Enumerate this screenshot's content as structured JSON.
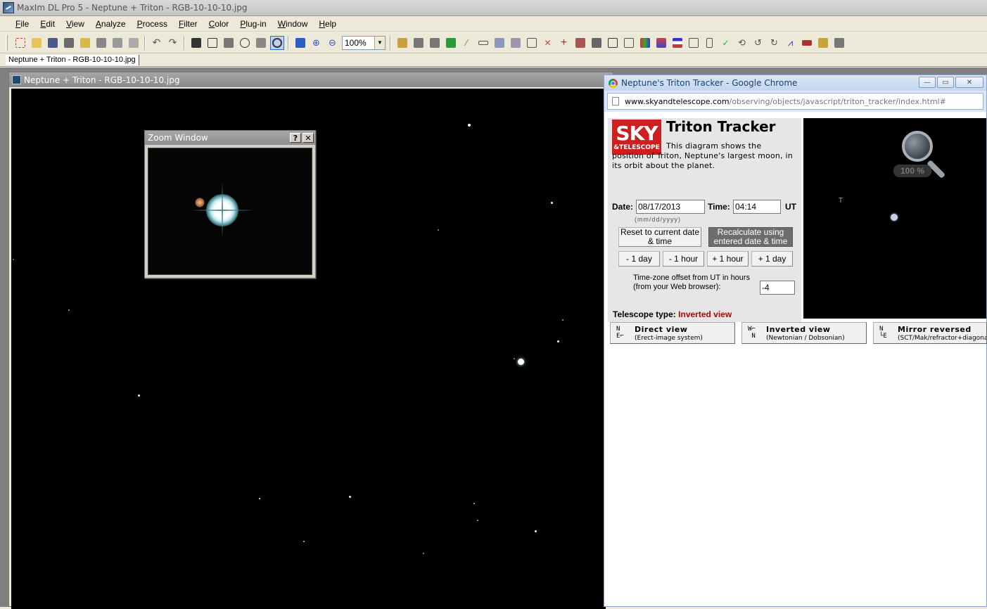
{
  "app": {
    "title": "MaxIm DL Pro 5 - Neptune + Triton - RGB-10-10-10.jpg",
    "menu": [
      "File",
      "Edit",
      "View",
      "Analyze",
      "Process",
      "Filter",
      "Color",
      "Plug-in",
      "Window",
      "Help"
    ],
    "zoom_value": "100%",
    "doc_tab": "Neptune + Triton - RGB-10-10-10.jpg"
  },
  "image_window": {
    "title": "Neptune + Triton - RGB-10-10-10.jpg"
  },
  "zoom_window": {
    "title": "Zoom Window",
    "help_label": "?",
    "close_label": "✕"
  },
  "chrome": {
    "title": "Neptune's Triton Tracker - Google Chrome",
    "url_host": "www.skyandtelescope.com",
    "url_path": "/observing/objects/javascript/triton_tracker/index.html#",
    "minimize": "—",
    "maximize": "▭",
    "close": "✕"
  },
  "tracker": {
    "logo_sky": "SKY",
    "logo_tel": "&TELESCOPE",
    "title": "Triton Tracker",
    "description": "This diagram shows the position of Triton, Neptune's largest moon, in its orbit about the planet.",
    "date_label": "Date:",
    "date_value": "08/17/2013",
    "date_hint": "(mm/dd/yyyy)",
    "time_label": "Time:",
    "time_value": "04:14",
    "ut_label": "UT",
    "reset_button": "Reset to current date & time",
    "recalc_button": "Recalculate using entered date & time",
    "step_buttons": [
      "- 1 day",
      "- 1 hour",
      "+ 1 hour",
      "+ 1 day"
    ],
    "tz_label": "Time-zone offset from UT in hours (from your Web browser):",
    "tz_value": "-4",
    "scope_label": "Telescope type:",
    "scope_value": "Inverted view",
    "views": [
      {
        "name": "Direct view",
        "sub": "(Erect-image system)",
        "compass_top": "N",
        "compass_bottom": "E"
      },
      {
        "name": "Inverted view",
        "sub": "(Newtonian / Dobsonian)",
        "compass_top": "W",
        "compass_bottom": "N"
      },
      {
        "name": "Mirror reversed",
        "sub": "(SCT/Mak/refractor+diagonal)",
        "compass_top": "N",
        "compass_bottom": "E"
      }
    ],
    "zoom_pct": "100 %",
    "triton_marker": "T"
  },
  "colors": {
    "logo_red": "#cc1f1f",
    "scope_value_red": "#bb0000",
    "sky_background": "#000000"
  }
}
